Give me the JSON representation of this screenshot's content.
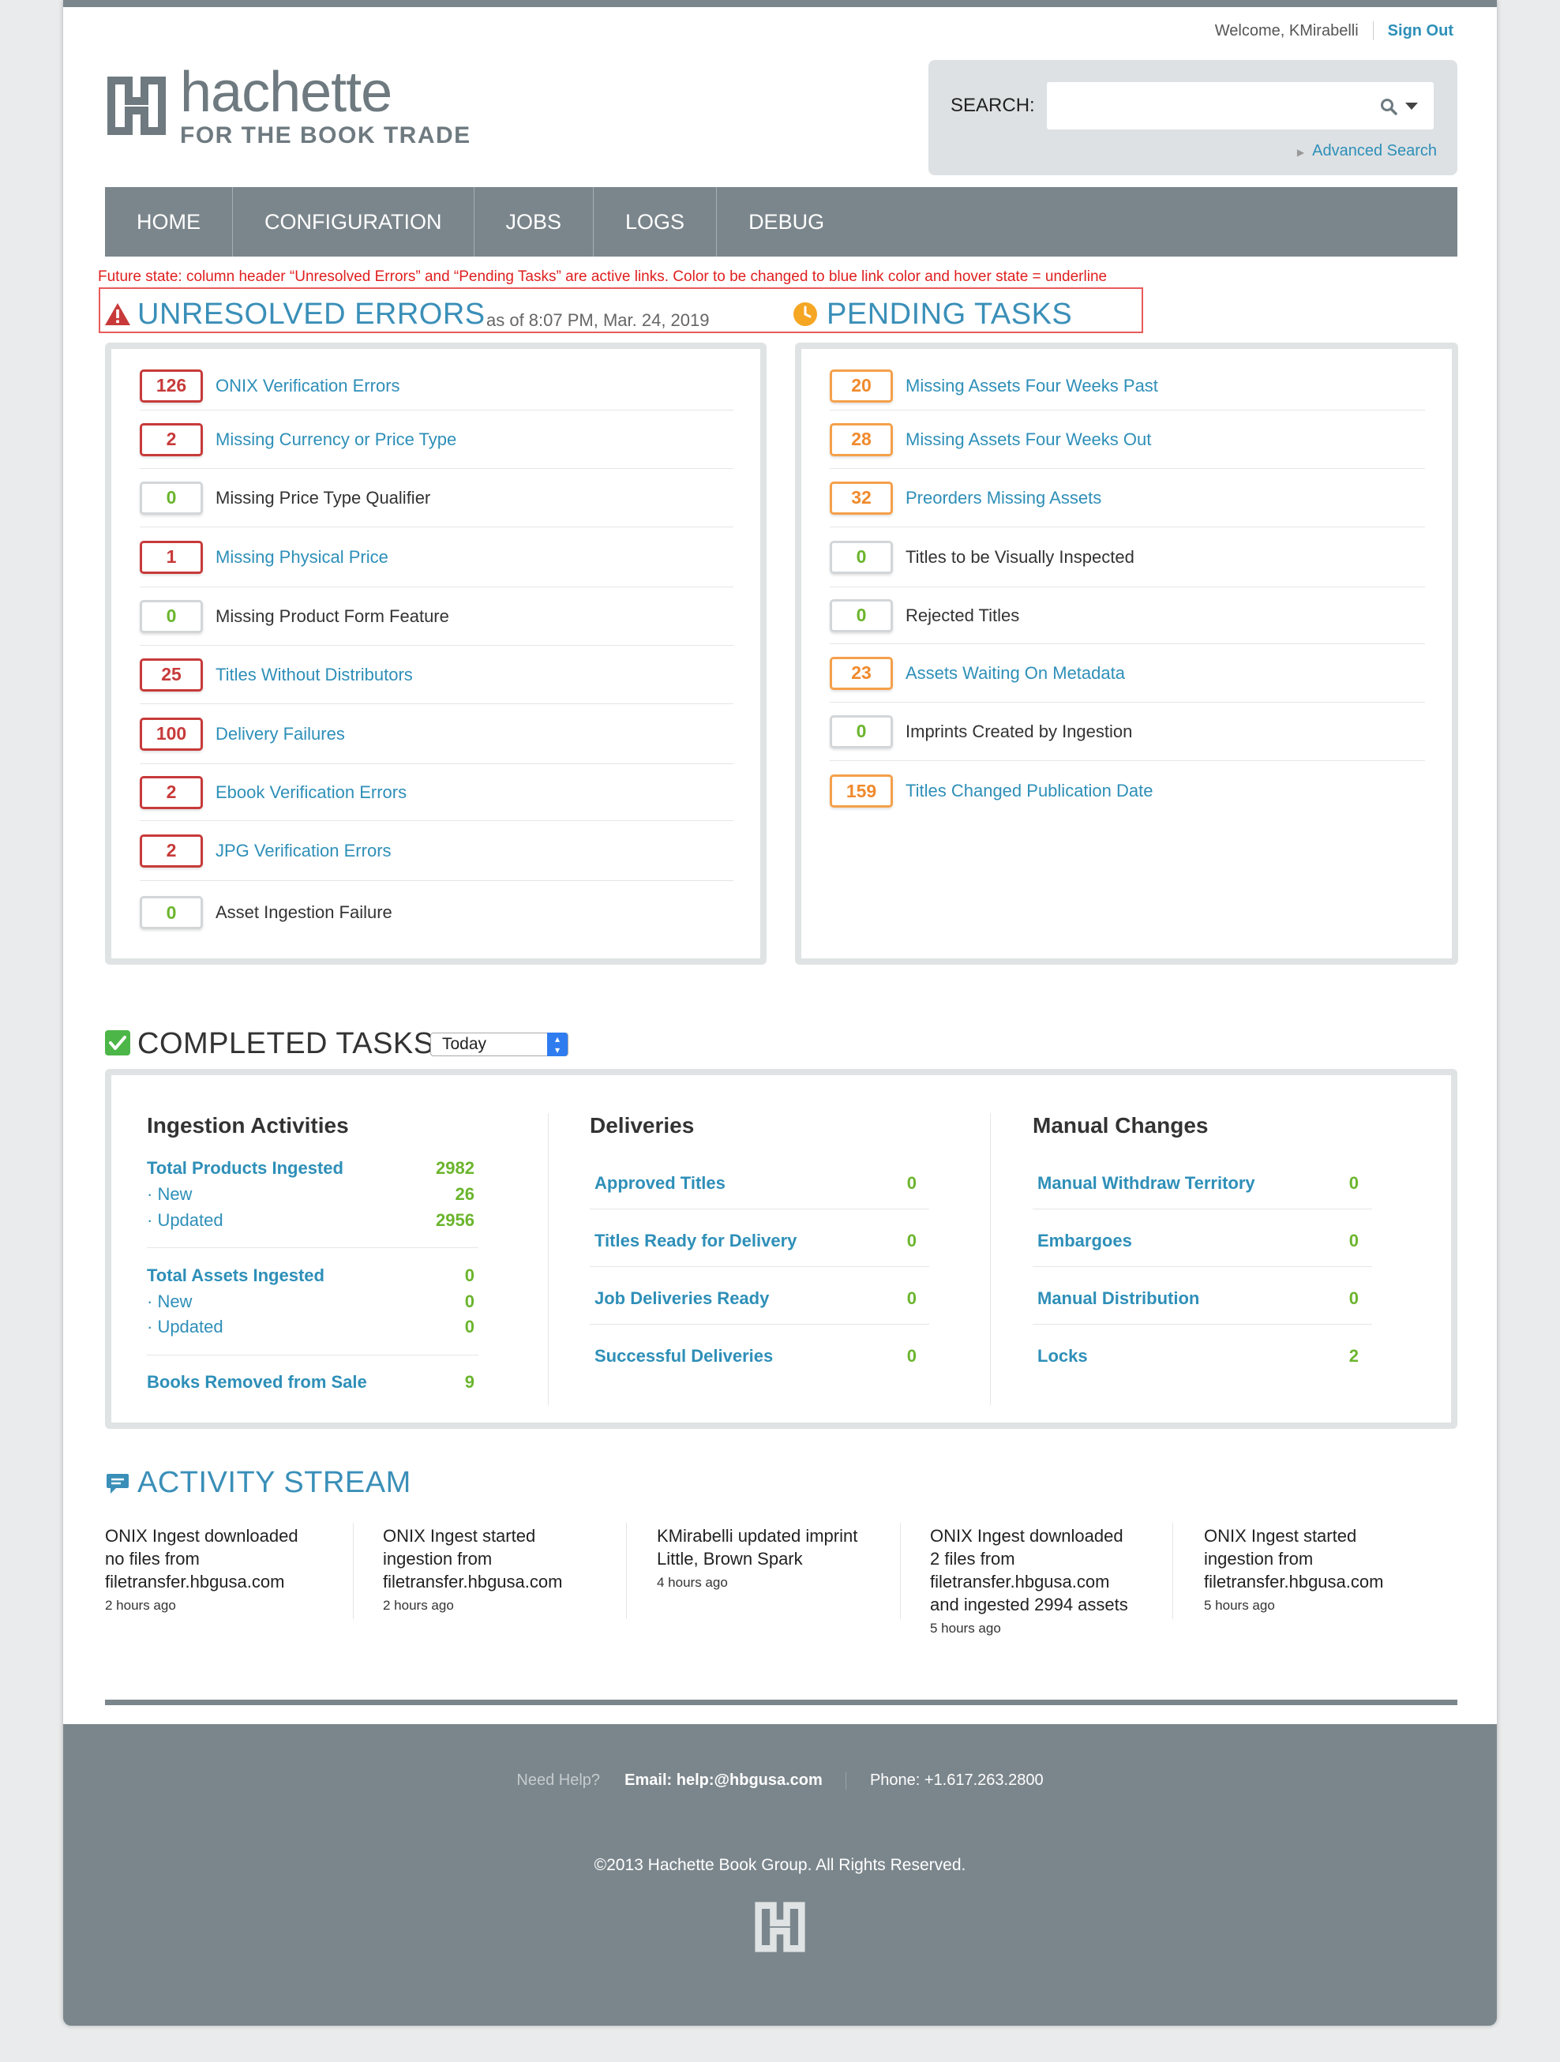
{
  "header": {
    "welcome": "Welcome, KMirabelli",
    "sign_out": "Sign Out",
    "logo_word": "hachette",
    "logo_sub": "FOR THE BOOK TRADE",
    "search_label": "SEARCH:",
    "search_value": "",
    "advanced_search": "Advanced Search"
  },
  "nav": [
    "HOME",
    "CONFIGURATION",
    "JOBS",
    "LOGS",
    "DEBUG"
  ],
  "note": "Future state: column header “Unresolved Errors” and “Pending Tasks” are active links. Color to be changed to blue link color and hover state = underline",
  "unresolved": {
    "title": "UNRESOLVED ERRORS",
    "as_of": "as of 8:07 PM, Mar. 24, 2019",
    "items": [
      {
        "count": "126",
        "label": "ONIX Verification Errors"
      },
      {
        "count": "2",
        "label": "Missing Currency or Price Type"
      },
      {
        "count": "0",
        "label": "Missing Price Type Qualifier"
      },
      {
        "count": "1",
        "label": "Missing Physical Price"
      },
      {
        "count": "0",
        "label": "Missing Product Form Feature"
      },
      {
        "count": "25",
        "label": "Titles Without Distributors"
      },
      {
        "count": "100",
        "label": "Delivery Failures"
      },
      {
        "count": "2",
        "label": "Ebook Verification Errors"
      },
      {
        "count": "2",
        "label": "JPG Verification Errors"
      },
      {
        "count": "0",
        "label": "Asset Ingestion Failure"
      }
    ]
  },
  "pending": {
    "title": "PENDING TASKS",
    "items": [
      {
        "count": "20",
        "label": "Missing Assets Four Weeks Past"
      },
      {
        "count": "28",
        "label": "Missing Assets Four Weeks Out"
      },
      {
        "count": "32",
        "label": "Preorders Missing Assets"
      },
      {
        "count": "0",
        "label": "Titles to be Visually Inspected"
      },
      {
        "count": "0",
        "label": "Rejected Titles"
      },
      {
        "count": "23",
        "label": "Assets Waiting On Metadata"
      },
      {
        "count": "0",
        "label": "Imprints Created by Ingestion"
      },
      {
        "count": "159",
        "label": "Titles Changed Publication Date"
      }
    ]
  },
  "completed": {
    "title": "COMPLETED TASKS",
    "period": "Today",
    "ingestion": {
      "title": "Ingestion Activities",
      "total_products": {
        "label": "Total Products Ingested",
        "value": "2982"
      },
      "products_new": {
        "label": "· New",
        "value": "26"
      },
      "products_updated": {
        "label": "· Updated",
        "value": "2956"
      },
      "total_assets": {
        "label": "Total Assets Ingested",
        "value": "0"
      },
      "assets_new": {
        "label": "· New",
        "value": "0"
      },
      "assets_updated": {
        "label": "· Updated",
        "value": "0"
      },
      "removed": {
        "label": "Books Removed from Sale",
        "value": "9"
      }
    },
    "deliveries": {
      "title": "Deliveries",
      "items": [
        {
          "label": "Approved Titles",
          "value": "0"
        },
        {
          "label": "Titles Ready for Delivery",
          "value": "0"
        },
        {
          "label": "Job Deliveries Ready",
          "value": "0"
        },
        {
          "label": "Successful Deliveries",
          "value": "0"
        }
      ]
    },
    "manual": {
      "title": "Manual Changes",
      "items": [
        {
          "label": "Manual Withdraw Territory",
          "value": "0"
        },
        {
          "label": "Embargoes",
          "value": "0"
        },
        {
          "label": "Manual Distribution",
          "value": "0"
        },
        {
          "label": "Locks",
          "value": "2"
        }
      ]
    }
  },
  "activity": {
    "title": "ACTIVITY STREAM",
    "items": [
      {
        "text": "ONIX Ingest downloaded no files from filetransfer.hbgusa.com",
        "time": "2 hours ago"
      },
      {
        "text": "ONIX Ingest started ingestion from filetransfer.hbgusa.com",
        "time": "2 hours ago"
      },
      {
        "text": "KMirabelli updated imprint Little, Brown Spark",
        "time": "4 hours ago"
      },
      {
        "text": "ONIX Ingest downloaded 2 files from filetransfer.hbgusa.com and ingested 2994 assets",
        "time": "5 hours ago"
      },
      {
        "text": "ONIX Ingest started ingestion from filetransfer.hbgusa.com",
        "time": "5 hours ago"
      }
    ]
  },
  "footer": {
    "need_help": "Need Help?",
    "email_label": "Email:",
    "email": "help:@hbgusa.com",
    "phone": "Phone: +1.617.263.2800",
    "copyright": "©2013 Hachette Book Group. All Rights Reserved."
  },
  "colors": {
    "nav_gray": "#7b868c",
    "link_blue": "#2e8fb8",
    "error_red": "#c83a3a",
    "pending_orange": "#f5a04a",
    "value_green": "#6bb52d"
  }
}
